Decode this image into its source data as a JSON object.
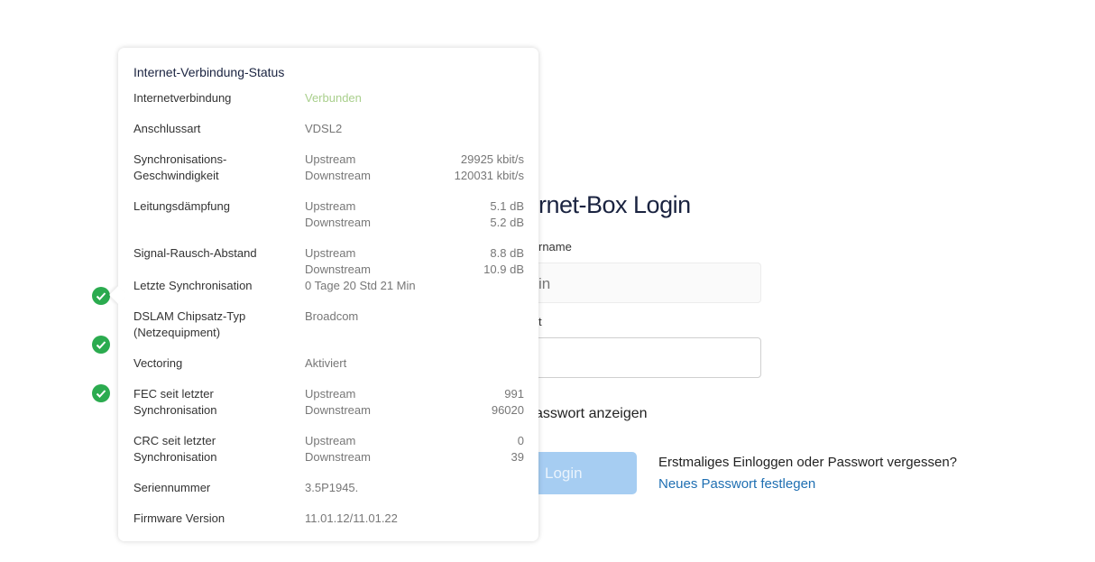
{
  "login": {
    "title_visible": "rnet-Box Login",
    "username_label_visible": "rname",
    "username_value_visible": "in",
    "password_label_visible": "t",
    "show_password_visible": "asswort anzeigen",
    "login_button": "Login",
    "help_text": "Erstmaliges Einloggen oder Passwort vergessen?",
    "help_link": "Neues Passwort festlegen"
  },
  "status_icons": [
    "check-circle-icon",
    "check-circle-icon",
    "check-circle-icon"
  ],
  "colors": {
    "accent_green": "#2bab4f",
    "connected": "#a9cf8c",
    "link": "#1f6fb2",
    "button": "#a6cdf2"
  },
  "popover": {
    "title": "Internet-Verbindung-Status",
    "rows": [
      {
        "label": "Internetverbindung",
        "values": [
          {
            "k": "Verbunden",
            "v": ""
          }
        ]
      },
      {
        "label": "Anschlussart",
        "values": [
          {
            "k": "VDSL2",
            "v": ""
          }
        ]
      },
      {
        "label": "Synchronisations-\nGeschwindigkeit",
        "values": [
          {
            "k": "Upstream",
            "v": "29925 kbit/s"
          },
          {
            "k": "Downstream",
            "v": "120031 kbit/s"
          }
        ]
      },
      {
        "label": "Leitungsdämpfung",
        "values": [
          {
            "k": "Upstream",
            "v": "5.1 dB"
          },
          {
            "k": "Downstream",
            "v": "5.2 dB"
          }
        ]
      },
      {
        "label": "Signal-Rausch-Abstand",
        "values": [
          {
            "k": "Upstream",
            "v": "8.8 dB"
          },
          {
            "k": "Downstream",
            "v": "10.9 dB"
          }
        ]
      },
      {
        "label": "Letzte Synchronisation",
        "values": [
          {
            "k": "0 Tage  20 Std  21 Min",
            "v": ""
          }
        ]
      },
      {
        "label": "DSLAM Chipsatz-Typ\n(Netzequipment)",
        "values": [
          {
            "k": "Broadcom",
            "v": ""
          }
        ]
      },
      {
        "label": "Vectoring",
        "values": [
          {
            "k": "Aktiviert",
            "v": ""
          }
        ]
      },
      {
        "label": "FEC seit letzter\nSynchronisation",
        "values": [
          {
            "k": "Upstream",
            "v": "991"
          },
          {
            "k": "Downstream",
            "v": "96020"
          }
        ]
      },
      {
        "label": "CRC seit letzter\nSynchronisation",
        "values": [
          {
            "k": "Upstream",
            "v": "0"
          },
          {
            "k": "Downstream",
            "v": "39"
          }
        ]
      },
      {
        "label": "Seriennummer",
        "values": [
          {
            "k": "3.5P1945.",
            "v": ""
          }
        ]
      },
      {
        "label": "Firmware Version",
        "values": [
          {
            "k": "11.01.12/11.01.22",
            "v": ""
          }
        ]
      }
    ]
  }
}
